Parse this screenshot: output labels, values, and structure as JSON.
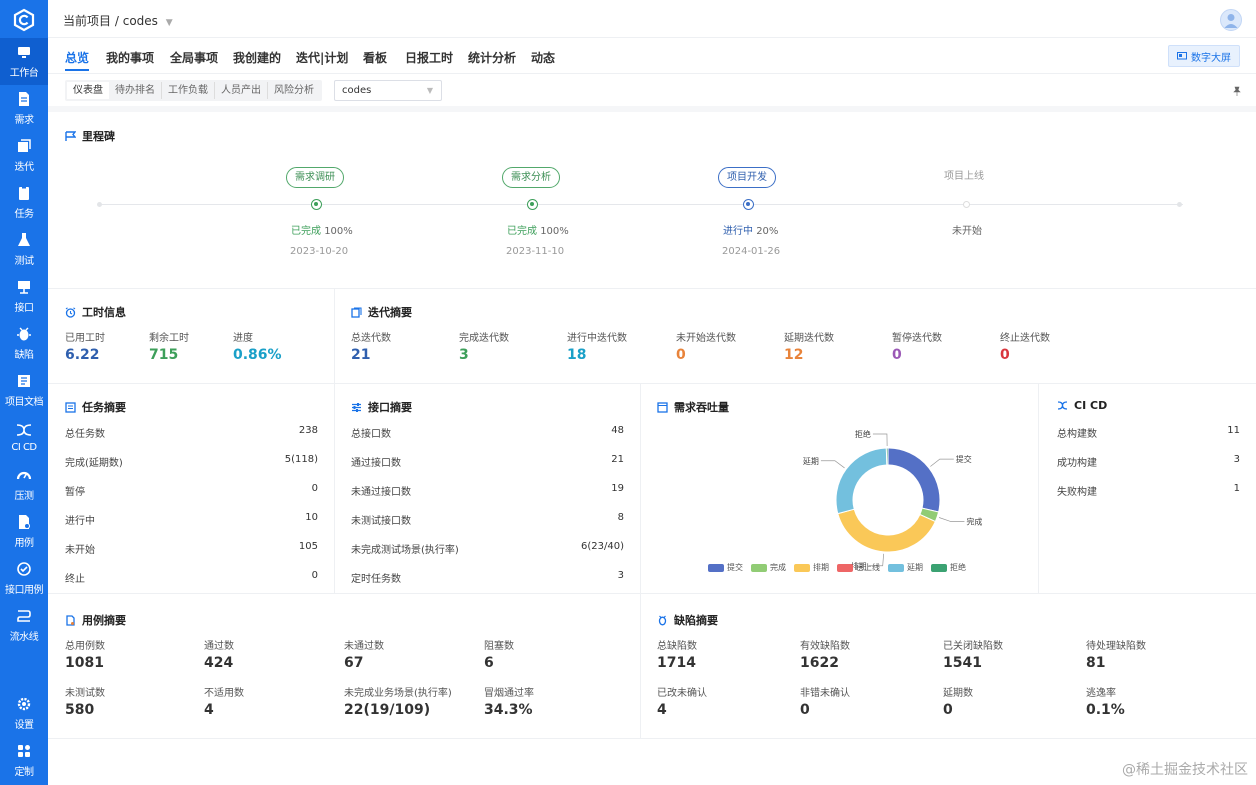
{
  "sidebar": {
    "items": [
      {
        "label": "工作台",
        "icon": "monitor-icon"
      },
      {
        "label": "需求",
        "icon": "document-icon"
      },
      {
        "label": "迭代",
        "icon": "layers-icon"
      },
      {
        "label": "任务",
        "icon": "clipboard-icon"
      },
      {
        "label": "测试",
        "icon": "flask-icon"
      },
      {
        "label": "接口",
        "icon": "api-icon"
      },
      {
        "label": "缺陷",
        "icon": "bug-icon"
      },
      {
        "label": "项目文档",
        "icon": "book-icon"
      },
      {
        "label": "CI CD",
        "icon": "cicd-icon"
      },
      {
        "label": "压测",
        "icon": "gauge-icon"
      },
      {
        "label": "用例",
        "icon": "testcase-icon"
      },
      {
        "label": "接口用例",
        "icon": "api-case-icon"
      },
      {
        "label": "流水线",
        "icon": "pipeline-icon"
      },
      {
        "label": "设置",
        "icon": "gear-icon"
      },
      {
        "label": "定制",
        "icon": "grid-icon"
      }
    ]
  },
  "header": {
    "breadcrumb_prefix": "当前项目",
    "breadcrumb_sep": "/",
    "project": "codes"
  },
  "tabs": [
    "总览",
    "我的事项",
    "全局事项",
    "我创建的",
    "迭代|计划",
    "看板",
    "日报工时",
    "统计分析",
    "动态"
  ],
  "bigscreen_label": "数字大屏",
  "subtabs": [
    "仪表盘",
    "待办排名",
    "工作负载",
    "人员产出",
    "风险分析"
  ],
  "select_value": "codes",
  "milestone": {
    "title": "里程碑",
    "nodes": [
      {
        "name": "需求调研",
        "status_label": "已完成",
        "percent": "100%",
        "date": "2023-10-20",
        "state": "done"
      },
      {
        "name": "需求分析",
        "status_label": "已完成",
        "percent": "100%",
        "date": "2023-11-10",
        "state": "done"
      },
      {
        "name": "项目开发",
        "status_label": "进行中",
        "percent": "20%",
        "date": "2024-01-26",
        "state": "prog"
      },
      {
        "name": "项目上线",
        "status_label": "未开始",
        "percent": "",
        "date": "",
        "state": "todo"
      }
    ]
  },
  "worktime": {
    "title": "工时信息",
    "stats": [
      {
        "label": "已用工时",
        "value": "6.22",
        "color": "#2f5fae"
      },
      {
        "label": "剩余工时",
        "value": "715",
        "color": "#3d9f5a"
      },
      {
        "label": "进度",
        "value": "0.86%",
        "color": "#1aa0c8"
      }
    ]
  },
  "iteration": {
    "title": "迭代摘要",
    "stats": [
      {
        "label": "总迭代数",
        "value": "21",
        "color": "#2f5fae"
      },
      {
        "label": "完成迭代数",
        "value": "3",
        "color": "#3d9f5a"
      },
      {
        "label": "进行中迭代数",
        "value": "18",
        "color": "#1aa0c8"
      },
      {
        "label": "未开始迭代数",
        "value": "0",
        "color": "#e8833a"
      },
      {
        "label": "延期迭代数",
        "value": "12",
        "color": "#e8833a"
      },
      {
        "label": "暂停迭代数",
        "value": "0",
        "color": "#9b59b6"
      },
      {
        "label": "终止迭代数",
        "value": "0",
        "color": "#d9363e"
      }
    ]
  },
  "task": {
    "title": "任务摘要",
    "rows": [
      {
        "label": "总任务数",
        "value": "238"
      },
      {
        "label": "完成(延期数)",
        "value": "5(118)"
      },
      {
        "label": "暂停",
        "value": "0"
      },
      {
        "label": "进行中",
        "value": "10"
      },
      {
        "label": "未开始",
        "value": "105"
      },
      {
        "label": "终止",
        "value": "0"
      }
    ]
  },
  "api": {
    "title": "接口摘要",
    "rows": [
      {
        "label": "总接口数",
        "value": "48"
      },
      {
        "label": "通过接口数",
        "value": "21"
      },
      {
        "label": "未通过接口数",
        "value": "19"
      },
      {
        "label": "未测试接口数",
        "value": "8"
      },
      {
        "label": "未完成测试场景(执行率)",
        "value": "6(23/40)"
      },
      {
        "label": "定时任务数",
        "value": "3"
      }
    ]
  },
  "throughput": {
    "title": "需求吞吐量"
  },
  "chart_data": {
    "type": "pie",
    "donut": true,
    "categories": [
      "提交",
      "完成",
      "排期",
      "已上线",
      "延期",
      "拒绝"
    ],
    "values": [
      28,
      3,
      38,
      0,
      28,
      0.5
    ],
    "colors": [
      "#5470c6",
      "#91cc75",
      "#fac858",
      "#ee6666",
      "#73c0de",
      "#3ba272"
    ],
    "outer_labels": [
      "提交",
      "完成",
      "排期",
      "已上线",
      "延期",
      "拒绝"
    ],
    "legend_position": "bottom"
  },
  "cicd": {
    "title": "CI CD",
    "rows": [
      {
        "label": "总构建数",
        "value": "11"
      },
      {
        "label": "成功构建",
        "value": "3"
      },
      {
        "label": "失败构建",
        "value": "1"
      }
    ]
  },
  "testcase": {
    "title": "用例摘要",
    "stats": [
      {
        "label": "总用例数",
        "value": "1081"
      },
      {
        "label": "通过数",
        "value": "424"
      },
      {
        "label": "未通过数",
        "value": "67"
      },
      {
        "label": "阻塞数",
        "value": "6"
      },
      {
        "label": "未测试数",
        "value": "580"
      },
      {
        "label": "不适用数",
        "value": "4"
      },
      {
        "label": "未完成业务场景(执行率)",
        "value": "22(19/109)"
      },
      {
        "label": "冒烟通过率",
        "value": "34.3%"
      }
    ]
  },
  "defect": {
    "title": "缺陷摘要",
    "stats": [
      {
        "label": "总缺陷数",
        "value": "1714"
      },
      {
        "label": "有效缺陷数",
        "value": "1622"
      },
      {
        "label": "已关闭缺陷数",
        "value": "1541"
      },
      {
        "label": "待处理缺陷数",
        "value": "81"
      },
      {
        "label": "已改未确认",
        "value": "4"
      },
      {
        "label": "非错未确认",
        "value": "0"
      },
      {
        "label": "延期数",
        "value": "0"
      },
      {
        "label": "逃逸率",
        "value": "0.1%"
      }
    ]
  },
  "watermark": "@稀土掘金技术社区"
}
